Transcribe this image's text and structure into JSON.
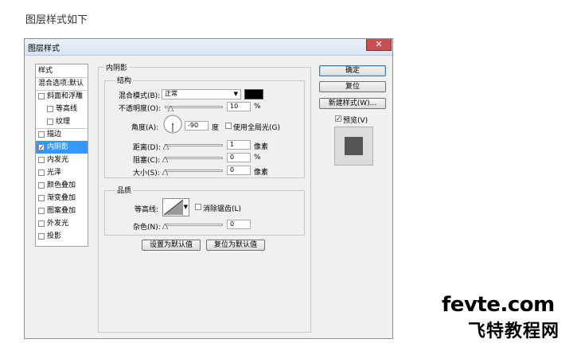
{
  "caption": "图层样式如下",
  "dialog": {
    "title": "图层样式",
    "close": "✕",
    "styles_list": {
      "header": "样式",
      "blend_default": "混合选项:默认",
      "items": [
        {
          "label": "斜面和浮雕",
          "checked": false,
          "indent": false,
          "selected": false
        },
        {
          "label": "等高线",
          "checked": false,
          "indent": true,
          "selected": false
        },
        {
          "label": "纹理",
          "checked": false,
          "indent": true,
          "selected": false
        },
        {
          "label": "描边",
          "checked": false,
          "indent": false,
          "selected": false
        },
        {
          "label": "内阴影",
          "checked": true,
          "indent": false,
          "selected": true
        },
        {
          "label": "内发光",
          "checked": false,
          "indent": false,
          "selected": false
        },
        {
          "label": "光泽",
          "checked": false,
          "indent": false,
          "selected": false
        },
        {
          "label": "颜色叠加",
          "checked": false,
          "indent": false,
          "selected": false
        },
        {
          "label": "渐变叠加",
          "checked": false,
          "indent": false,
          "selected": false
        },
        {
          "label": "图案叠加",
          "checked": false,
          "indent": false,
          "selected": false
        },
        {
          "label": "外发光",
          "checked": false,
          "indent": false,
          "selected": false
        },
        {
          "label": "投影",
          "checked": false,
          "indent": false,
          "selected": false
        }
      ]
    },
    "inner_shadow": {
      "title": "内阴影",
      "structure": {
        "title": "结构",
        "blend_mode_label": "混合模式(B):",
        "blend_mode_value": "正常",
        "shadow_color": "#000000",
        "opacity_label": "不透明度(O):",
        "opacity_value": "10",
        "percent": "%",
        "angle_label": "角度(A):",
        "angle_value": "-90",
        "degree_unit": "度",
        "global_light_label": "使用全局光(G)",
        "global_light_checked": false,
        "distance_label": "距离(D):",
        "distance_value": "1",
        "choke_label": "阻塞(C):",
        "choke_value": "0",
        "size_label": "大小(S):",
        "size_value": "0",
        "pixel_unit": "像素",
        "opacity_fraction": 0.1,
        "distance_fraction": 0.01,
        "choke_fraction": 0.0,
        "size_fraction": 0.0
      },
      "quality": {
        "title": "品质",
        "contour_label": "等高线:",
        "antialias_label": "消除锯齿(L)",
        "antialias_checked": false,
        "noise_label": "杂色(N):",
        "noise_value": "0",
        "noise_fraction": 0.0
      },
      "make_default": "设置为默认值",
      "reset_default": "复位为默认值"
    },
    "buttons": {
      "ok": "确定",
      "reset": "复位",
      "new_style": "新建样式(W)...",
      "preview_label": "预览(V)",
      "preview_checked": true
    }
  },
  "watermark": {
    "line1": "fevte.com",
    "line2": "飞特教程网"
  }
}
